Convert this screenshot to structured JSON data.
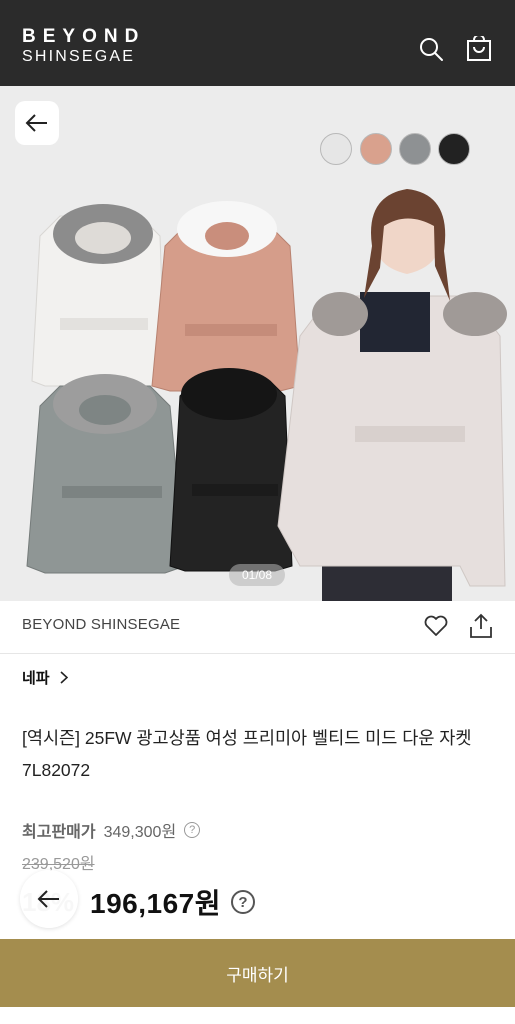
{
  "header": {
    "logo_line1": "BEYOND",
    "logo_line2": "SHINSEGAE",
    "icons": [
      "search-icon",
      "shopping-bag-icon"
    ]
  },
  "hero": {
    "image_counter": "01/08",
    "swatches": [
      "#e6e6e6",
      "#d9a18d",
      "#8e9193",
      "#222222"
    ]
  },
  "product": {
    "brand": "BEYOND SHINSEGAE",
    "category": "네파",
    "title": "[역시즌] 25FW 광고상품 여성 프리미아 벨티드 미드 다운 자켓 7L82072",
    "max_price_label": "최고판매가",
    "max_price": "349,300원",
    "original_price": "239,520원",
    "discount": "18%",
    "sale_price": "196,167원",
    "help_glyph": "?"
  },
  "buy_button_label": "구매하기",
  "colors": {
    "header_bg": "#2b2b2b",
    "buy_button": "#a48d4e"
  }
}
